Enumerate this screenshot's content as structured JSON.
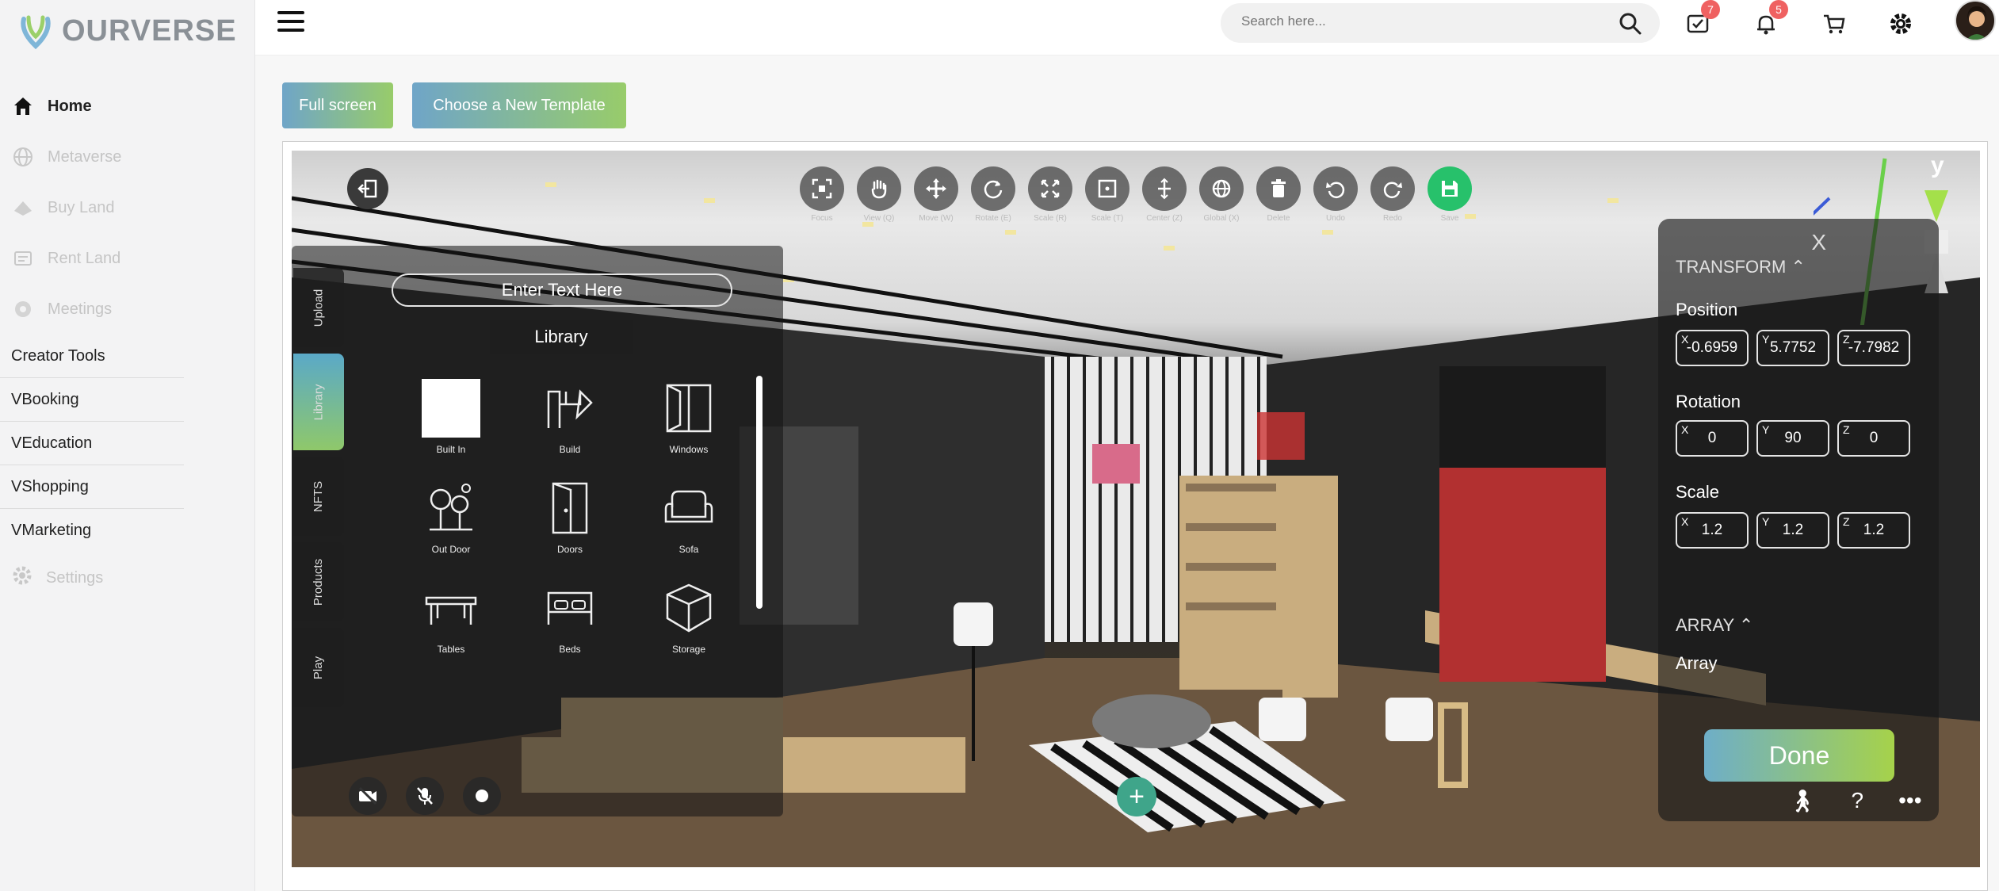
{
  "brand": {
    "name_part1": "OUR",
    "name_part2": "VERSE",
    "accent": "#6b7bd6",
    "gradient": [
      "#6fa5c8",
      "#98cc6a"
    ]
  },
  "sidebar": {
    "icon_items": [
      {
        "label": "Home",
        "icon": "home-icon",
        "active": true
      },
      {
        "label": "Metaverse",
        "icon": "globe-icon",
        "active": false
      },
      {
        "label": "Buy Land",
        "icon": "land-icon",
        "active": false
      },
      {
        "label": "Rent Land",
        "icon": "rent-icon",
        "active": false
      },
      {
        "label": "Meetings",
        "icon": "meeting-icon",
        "active": false
      }
    ],
    "text_items": [
      "Creator Tools",
      "VBooking",
      "VEducation",
      "VShopping",
      "VMarketing"
    ],
    "settings_label": "Settings"
  },
  "topbar": {
    "search_placeholder": "Search here...",
    "messages_badge": "7",
    "notifications_badge": "5"
  },
  "buttons": {
    "full_screen": "Full screen",
    "choose_template": "Choose a New Template"
  },
  "toolbar": {
    "tools": [
      {
        "label": "Focus",
        "icon": "focus-icon"
      },
      {
        "label": "View (Q)",
        "icon": "hand-icon"
      },
      {
        "label": "Move (W)",
        "icon": "move-icon"
      },
      {
        "label": "Rotate (E)",
        "icon": "rotate-icon"
      },
      {
        "label": "Scale (R)",
        "icon": "scale-icon"
      },
      {
        "label": "Scale (T)",
        "icon": "bounds-icon"
      },
      {
        "label": "Center (Z)",
        "icon": "center-icon"
      },
      {
        "label": "Global (X)",
        "icon": "globe-icon"
      },
      {
        "label": "Delete",
        "icon": "trash-icon"
      },
      {
        "label": "Undo",
        "icon": "undo-icon"
      },
      {
        "label": "Redo",
        "icon": "redo-icon"
      },
      {
        "label": "Save",
        "icon": "save-icon"
      }
    ]
  },
  "library": {
    "text_placeholder": "Enter Text Here",
    "title": "Library",
    "tabs": [
      "Upload",
      "Library",
      "NFTS",
      "Products",
      "Play"
    ],
    "active_tab": "Library",
    "items": [
      "Built In",
      "Build",
      "Windows",
      "Out Door",
      "Doors",
      "Sofa",
      "Tables",
      "Beds",
      "Storage"
    ]
  },
  "transform": {
    "close": "X",
    "heading": "TRANSFORM",
    "position_label": "Position",
    "position": {
      "x": "-0.6959",
      "y": "5.7752",
      "z": "-7.7982"
    },
    "rotation_label": "Rotation",
    "rotation": {
      "x": "0",
      "y": "90",
      "z": "0"
    },
    "scale_label": "Scale",
    "scale": {
      "x": "1.2",
      "y": "1.2",
      "z": "1.2"
    },
    "array_heading": "ARRAY",
    "array_label": "Array"
  },
  "gizmo": {
    "y_label": "y"
  },
  "done_label": "Done"
}
